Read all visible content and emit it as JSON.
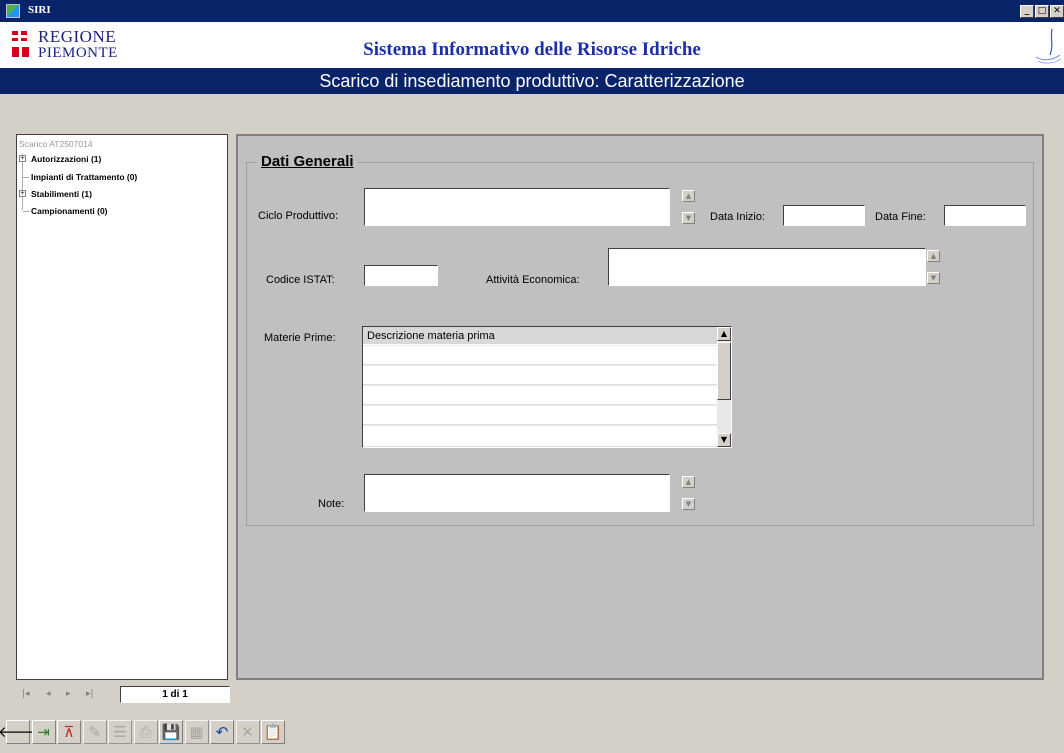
{
  "window": {
    "title": "SIRI",
    "buttons": [
      "_",
      "□",
      "✕"
    ]
  },
  "header": {
    "logo_line1": "REGIONE",
    "logo_line2": "PIEMONTE",
    "app_title": "Sistema Informativo delle Risorse Idriche"
  },
  "subtitle": "Scarico di insediamento produttivo: Caratterizzazione",
  "tree": {
    "root": "Scarico AT2507014",
    "items": [
      {
        "label": "Autorizzazioni (1)",
        "expandable": true
      },
      {
        "label": "Impianti di Trattamento (0)",
        "expandable": false
      },
      {
        "label": "Stabilimenti (1)",
        "expandable": true
      },
      {
        "label": "Campionamenti (0)",
        "expandable": false
      }
    ]
  },
  "form": {
    "group_title": "Dati Generali",
    "ciclo_produttivo": {
      "label": "Ciclo Produttivo:",
      "value": ""
    },
    "data_inizio": {
      "label": "Data Inizio:",
      "value": ""
    },
    "data_fine": {
      "label": "Data Fine:",
      "value": ""
    },
    "codice_istat": {
      "label": "Codice ISTAT:",
      "value": ""
    },
    "attivita_economica": {
      "label": "Attività Economica:",
      "value": ""
    },
    "materie_prime": {
      "label": "Materie Prime:",
      "column_header": "Descrizione materia prima",
      "rows": [
        "",
        "",
        "",
        "",
        ""
      ]
    },
    "note": {
      "label": "Note:",
      "value": ""
    }
  },
  "navigation": {
    "first": "|◂",
    "prev": "◂",
    "next": "▸",
    "last": "▸|",
    "page": "1 di 1"
  },
  "toolbar": {
    "buttons": [
      {
        "name": "back-button",
        "icon": "arrow-left-icon",
        "glyph": "🡐",
        "enabled": true
      },
      {
        "name": "exit-button",
        "icon": "door-exit-icon",
        "glyph": "⇥",
        "enabled": true
      },
      {
        "name": "hierarchy-button",
        "icon": "hierarchy-icon",
        "glyph": "⊼",
        "enabled": true
      },
      {
        "name": "edit-button",
        "icon": "edit-icon",
        "glyph": "✎",
        "enabled": false
      },
      {
        "name": "tree-button",
        "icon": "tree-icon",
        "glyph": "☰",
        "enabled": false
      },
      {
        "name": "print-button",
        "icon": "print-icon",
        "glyph": "⎙",
        "enabled": false
      },
      {
        "name": "save-button",
        "icon": "floppy-disk-icon",
        "glyph": "💾",
        "enabled": true
      },
      {
        "name": "table-button",
        "icon": "table-icon",
        "glyph": "▦",
        "enabled": false
      },
      {
        "name": "undo-button",
        "icon": "undo-icon",
        "glyph": "↶",
        "enabled": true
      },
      {
        "name": "delete-button",
        "icon": "delete-x-icon",
        "glyph": "✕",
        "enabled": false
      },
      {
        "name": "clipboard-button",
        "icon": "clipboard-icon",
        "glyph": "📋",
        "enabled": true
      }
    ]
  },
  "colors": {
    "titlebar": "#0a246a",
    "app_title": "#1c2fa8",
    "logo_red": "#d6001c",
    "panel": "#c0c0c0",
    "background": "#d4d0c8"
  }
}
